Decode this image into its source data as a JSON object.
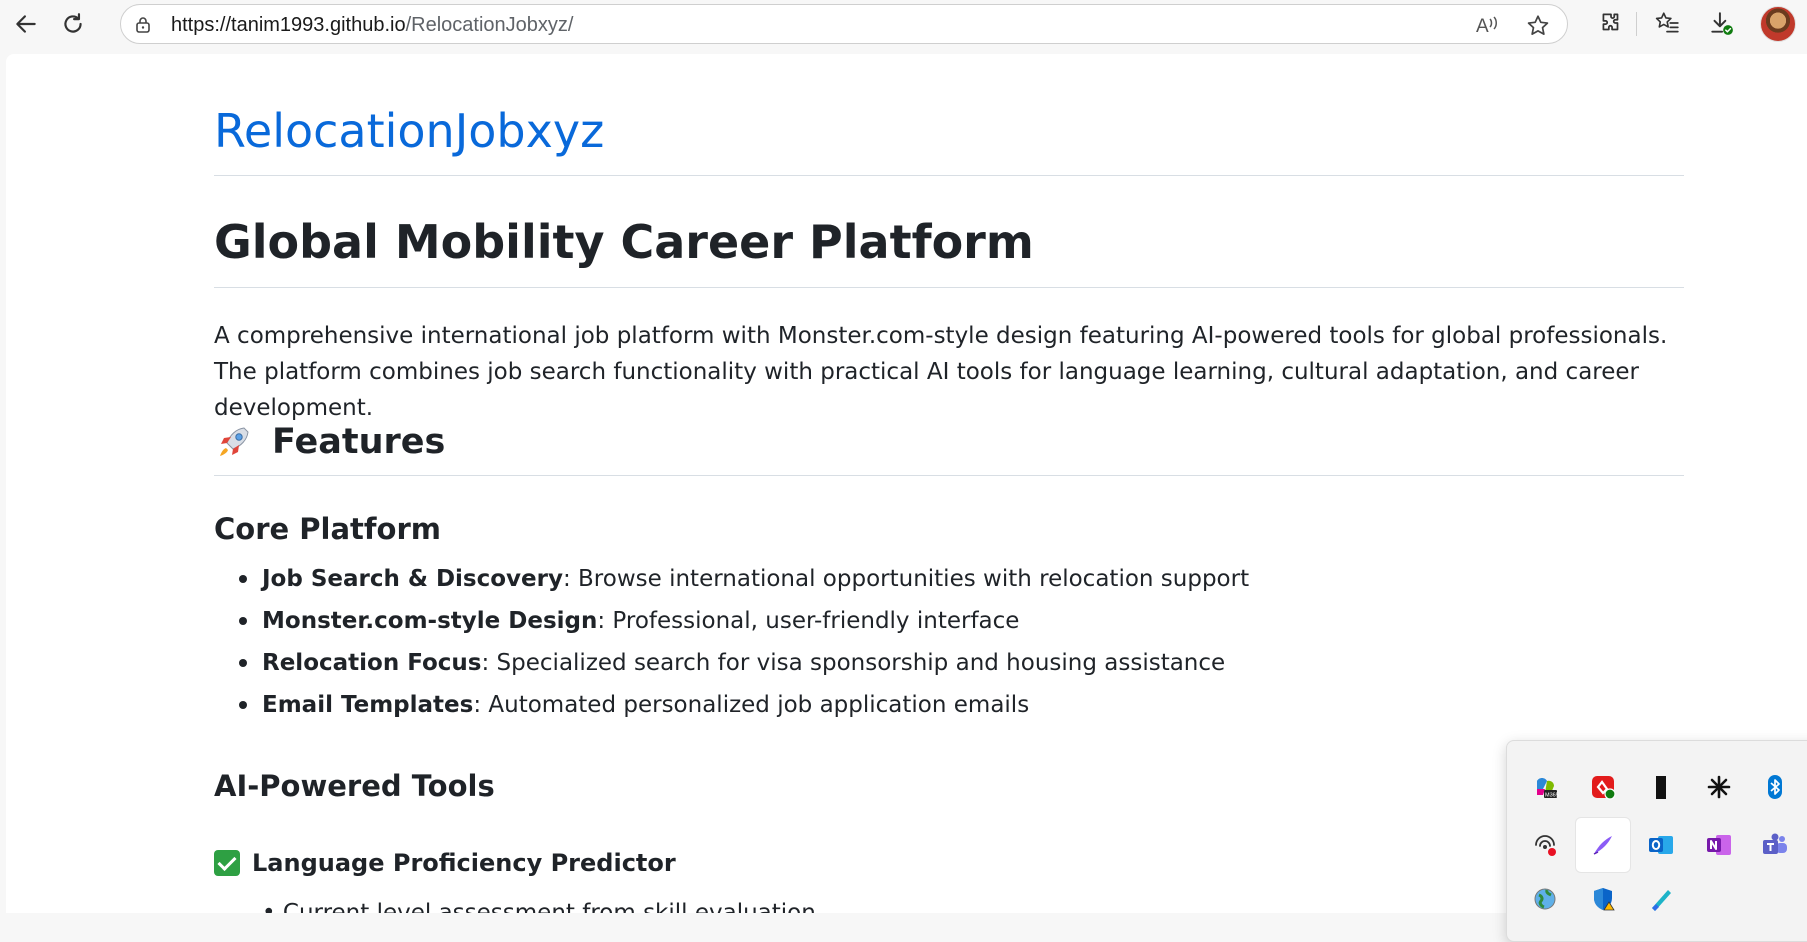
{
  "browser": {
    "url_host": "https://tanim1993.github.io",
    "url_path": "/RelocationJobxyz/",
    "read_aloud_label": "Á)",
    "icons": [
      "back-icon",
      "refresh-icon",
      "lock-icon",
      "read-aloud-icon",
      "favorite-star-icon",
      "extensions-icon",
      "favorites-icon",
      "downloads-icon",
      "profile-avatar"
    ]
  },
  "page": {
    "site_title": "RelocationJobxyz",
    "h1": "Global Mobility Career Platform",
    "intro": "A comprehensive international job platform with Monster.com-style design featuring AI-powered tools for global professionals. The platform combines job search functionality with practical AI tools for language learning, cultural adaptation, and career development.",
    "features_heading": "Features",
    "core_heading": "Core Platform",
    "core_items": [
      {
        "title": "Job Search & Discovery",
        "desc": ": Browse international opportunities with relocation support"
      },
      {
        "title": "Monster.com-style Design",
        "desc": ": Professional, user-friendly interface"
      },
      {
        "title": "Relocation Focus",
        "desc": ": Specialized search for visa sponsorship and housing assistance"
      },
      {
        "title": "Email Templates",
        "desc": ": Automated personalized job application emails"
      }
    ],
    "ai_heading": "AI-Powered Tools",
    "tool1_heading": "Language Proficiency Predictor",
    "cutoff_text": "Current level assessment from skill evaluation"
  },
  "tray": {
    "icons": [
      "m365-copilot-icon",
      "security-app-icon",
      "black-app-icon",
      "asterisk-app-icon",
      "bluetooth-icon",
      "wifi-hotspot-icon",
      "pen-app-icon",
      "outlook-icon",
      "onenote-icon",
      "teams-icon",
      "globe-network-icon",
      "defender-shield-icon",
      "copilot-stroke-icon"
    ],
    "colors": {
      "bluetooth": "#0078d4",
      "outlook": "#0a64c8",
      "onenote": "#7719aa",
      "teams": "#5b5fc7"
    }
  },
  "colors": {
    "link": "#0969da",
    "text": "#1f2328",
    "check": "#2ea043"
  }
}
